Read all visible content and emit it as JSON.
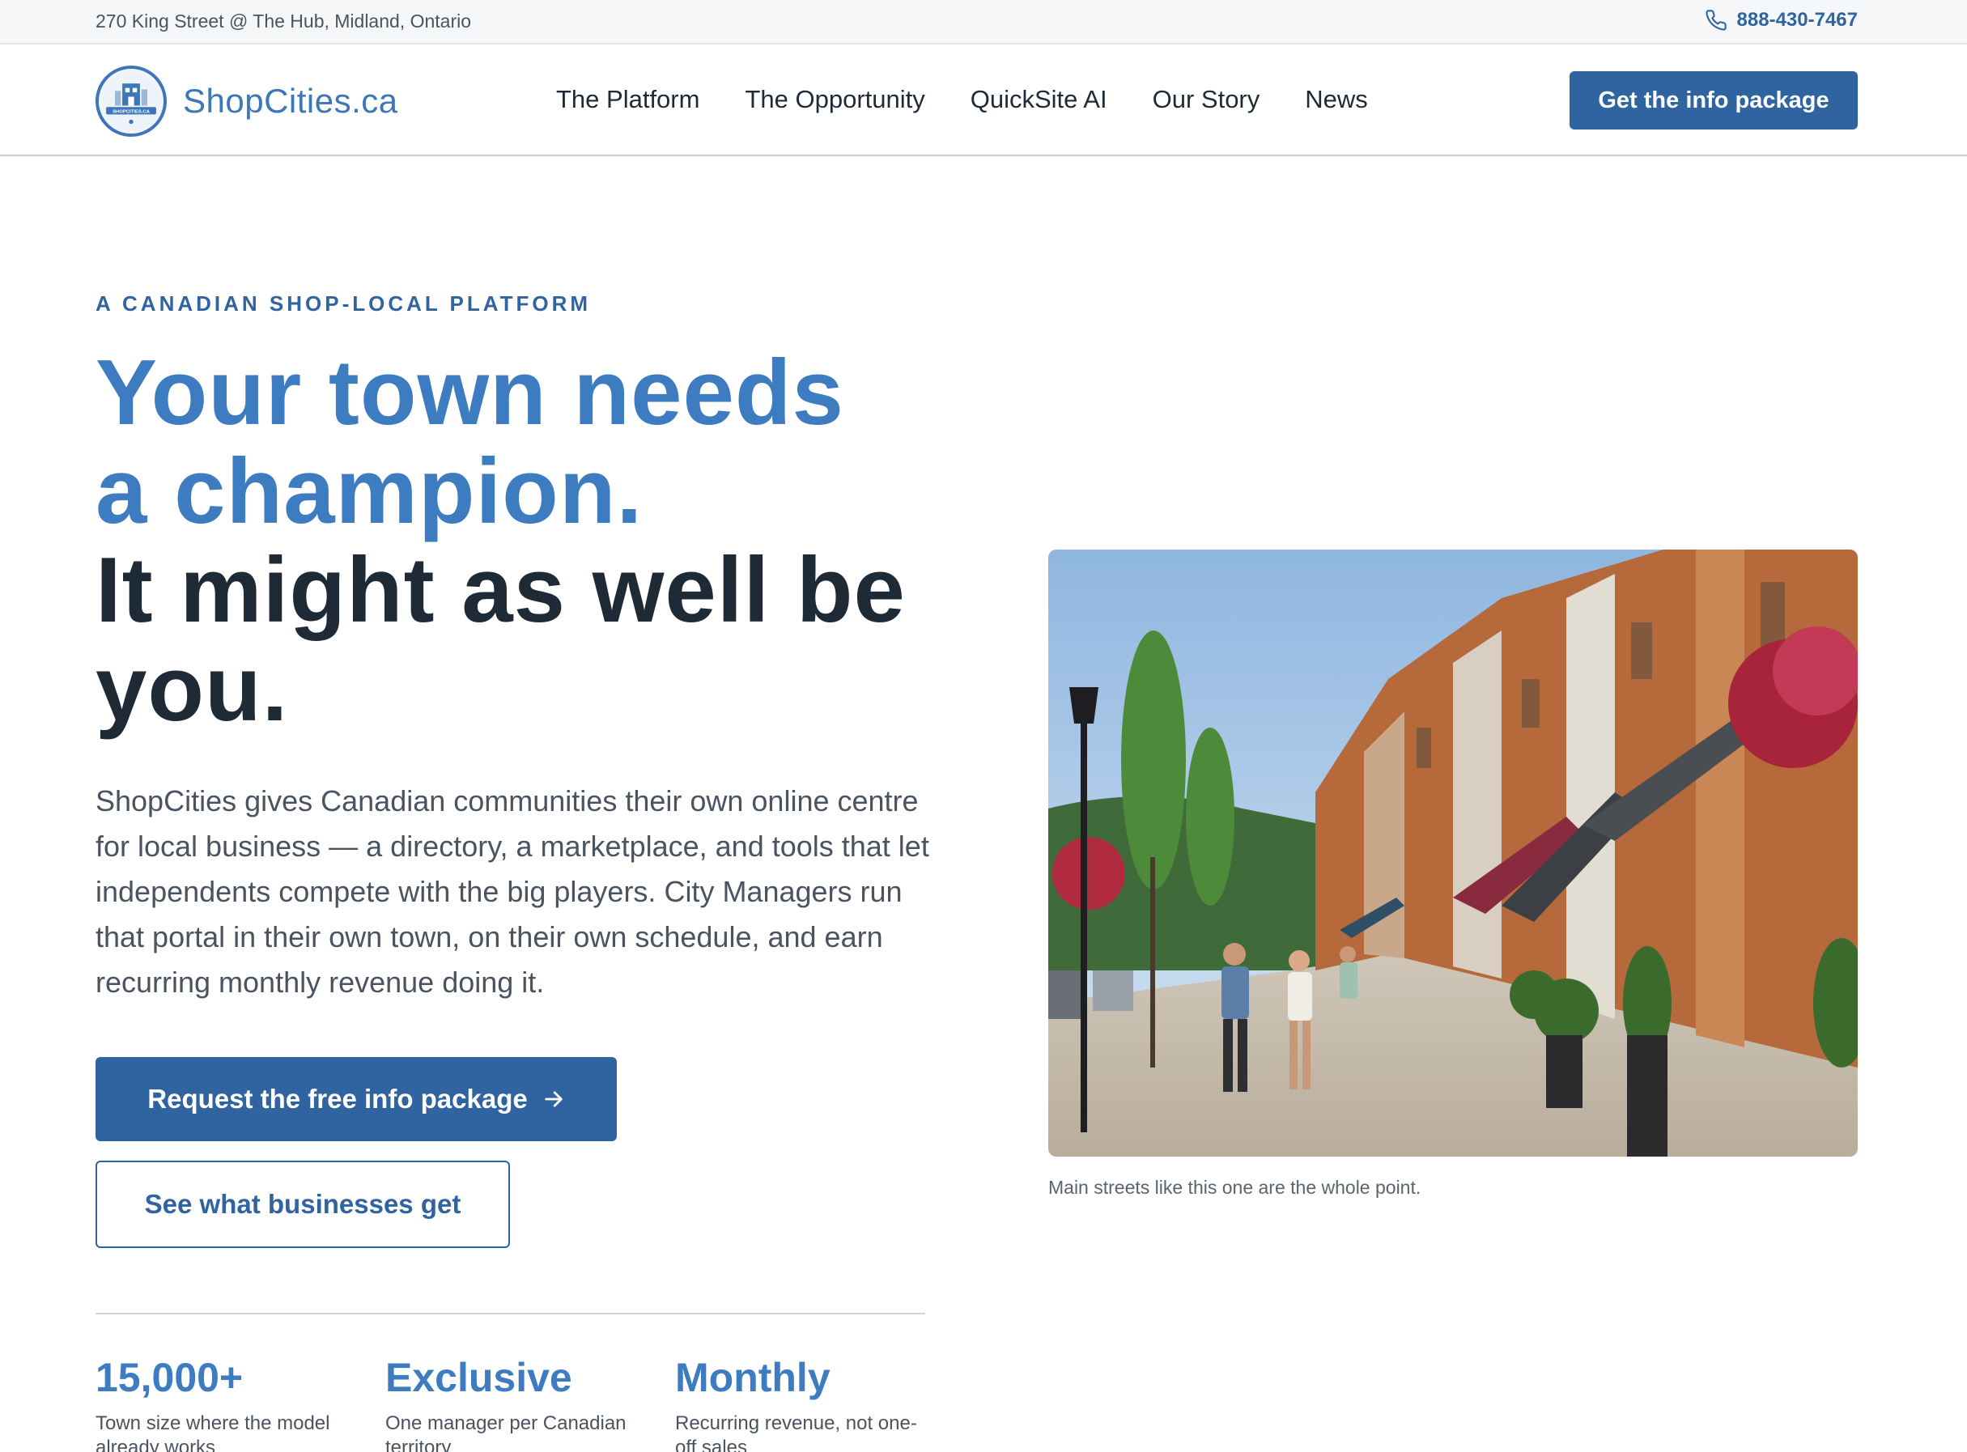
{
  "topbar": {
    "address": "270 King Street @ The Hub, Midland, Ontario",
    "phone": "888-430-7467",
    "phone_icon": "phone-icon"
  },
  "header": {
    "logo_text": "ShopCities.ca",
    "logo_badge_text": "SHOPCITIES.CA",
    "nav": [
      "The Platform",
      "The Opportunity",
      "QuickSite AI",
      "Our Story",
      "News"
    ],
    "cta": "Get the info package"
  },
  "hero": {
    "eyebrow": "A CANADIAN SHOP-LOCAL PLATFORM",
    "headline_blue_1": "Your town needs",
    "headline_blue_2": "a champion.",
    "headline_dark_1": "It might as well be",
    "headline_dark_2": "you.",
    "lede": "ShopCities gives Canadian communities their own online centre for local business — a directory, a marketplace, and tools that let independents compete with the big players. City Managers run that portal in their own town, on their own schedule, and earn recurring monthly revenue doing it.",
    "primary_button": "Request the free info package",
    "primary_button_icon": "arrow-right-icon",
    "secondary_button": "See what businesses get",
    "image_caption": "Main streets like this one are the whole point."
  },
  "stats": [
    {
      "value": "15,000+",
      "desc": "Town size where the model already works"
    },
    {
      "value": "Exclusive",
      "desc": "One manager per Canadian territory"
    },
    {
      "value": "Monthly",
      "desc": "Recurring revenue, not one-off sales"
    }
  ],
  "colors": {
    "brand_blue": "#2f64a0",
    "headline_blue": "#3d7cc0",
    "text_dark": "#1f2a37",
    "text_muted": "#4a5360"
  }
}
